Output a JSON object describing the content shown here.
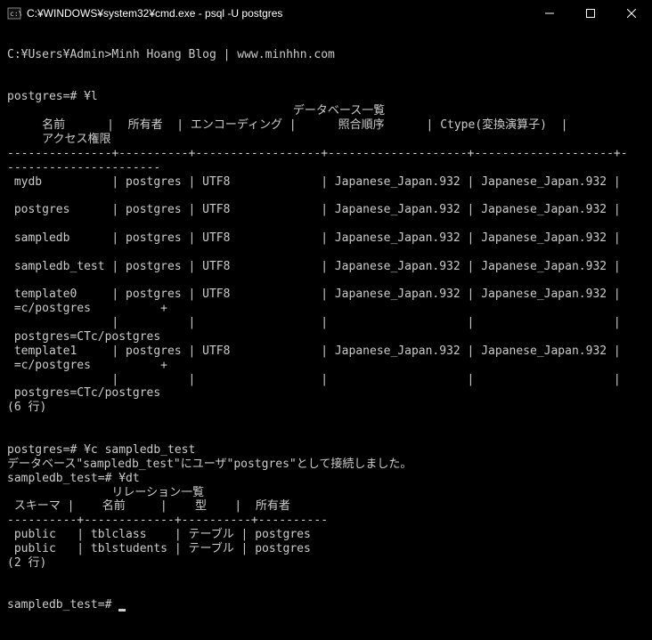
{
  "titlebar": {
    "title": "C:¥WINDOWS¥system32¥cmd.exe - psql  -U postgres"
  },
  "prompt_line": "C:¥Users¥Admin>Minh Hoang Blog | www.minhhn.com",
  "db_cmd": "postgres=# ¥l",
  "db_list": {
    "heading": "                                         データベース一覧",
    "header1": "     名前      |  所有者  | エンコーディング |      照合順序      | Ctype(変換演算子)  |",
    "header2": "     アクセス権限",
    "sep": "---------------+----------+------------------+--------------------+--------------------+-",
    "sep2": "----------------------",
    "rows": [
      " mydb          | postgres | UTF8             | Japanese_Japan.932 | Japanese_Japan.932 |",
      "",
      " postgres      | postgres | UTF8             | Japanese_Japan.932 | Japanese_Japan.932 |",
      "",
      " sampledb      | postgres | UTF8             | Japanese_Japan.932 | Japanese_Japan.932 |",
      "",
      " sampledb_test | postgres | UTF8             | Japanese_Japan.932 | Japanese_Japan.932 |",
      "",
      " template0     | postgres | UTF8             | Japanese_Japan.932 | Japanese_Japan.932 |",
      " =c/postgres          +",
      "               |          |                  |                    |                    |",
      " postgres=CTc/postgres",
      " template1     | postgres | UTF8             | Japanese_Japan.932 | Japanese_Japan.932 |",
      " =c/postgres          +",
      "               |          |                  |                    |                    |",
      " postgres=CTc/postgres"
    ],
    "footer": "(6 行)"
  },
  "connect_cmd": "postgres=# ¥c sampledb_test",
  "connect_msg": "データベース\"sampledb_test\"にユーザ\"postgres\"として接続しました。",
  "dt_cmd": "sampledb_test=# ¥dt",
  "rel_list": {
    "heading": "               リレーション一覧",
    "header": " スキーマ |    名前     |    型    |  所有者",
    "sep": "----------+-------------+----------+----------",
    "rows": [
      " public   | tblclass    | テーブル | postgres",
      " public   | tblstudents | テーブル | postgres"
    ],
    "footer": "(2 行)"
  },
  "final_prompt": "sampledb_test=# "
}
